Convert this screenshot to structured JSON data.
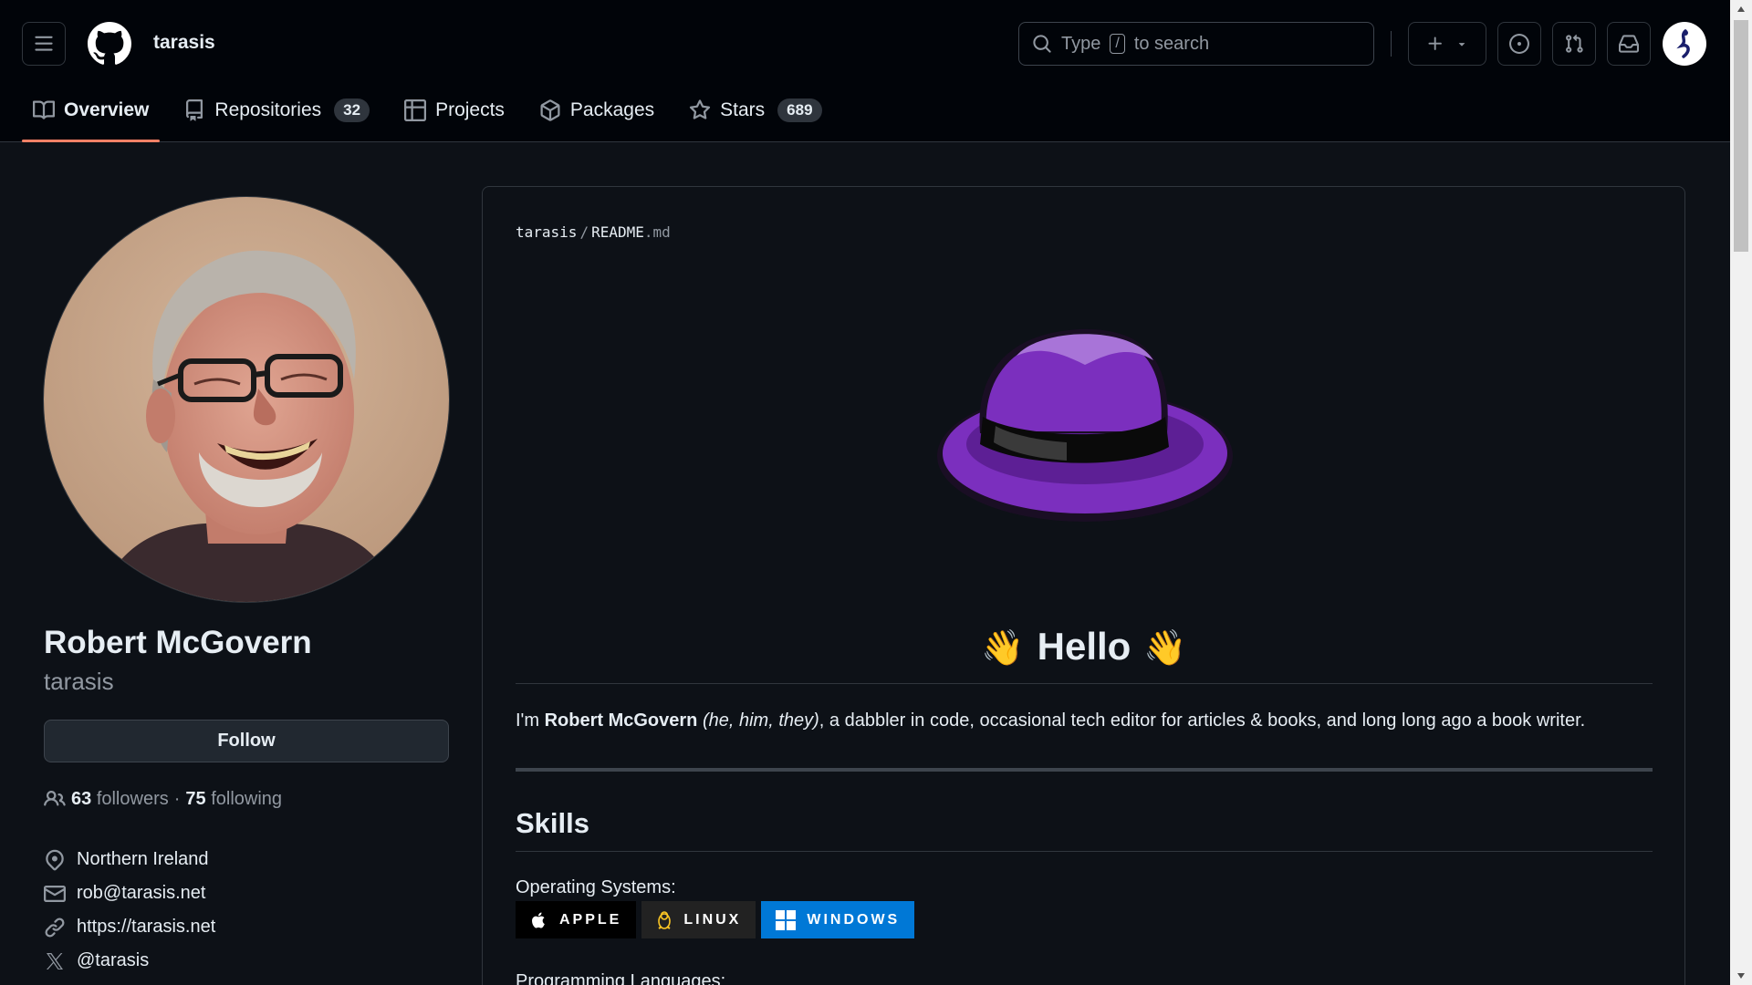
{
  "header": {
    "menu_icon": "hamburger-icon",
    "logo_icon": "github-octocat-icon",
    "owner": "tarasis",
    "search": {
      "prefix": "Type",
      "key": "/",
      "suffix": "to search"
    },
    "buttons": [
      "plus-icon",
      "caret-down-icon",
      "issue-icon",
      "pull-request-icon",
      "inbox-icon"
    ]
  },
  "tabs": [
    {
      "label": "Overview",
      "icon": "book-icon",
      "active": true
    },
    {
      "label": "Repositories",
      "icon": "repo-icon",
      "count": "32"
    },
    {
      "label": "Projects",
      "icon": "table-icon"
    },
    {
      "label": "Packages",
      "icon": "package-icon"
    },
    {
      "label": "Stars",
      "icon": "star-icon",
      "count": "689"
    }
  ],
  "profile": {
    "full_name": "Robert McGovern",
    "login": "tarasis",
    "follow_label": "Follow",
    "followers_count": "63",
    "followers_label": "followers",
    "separator": "·",
    "following_count": "75",
    "following_label": "following",
    "location": "Northern Ireland",
    "email": "rob@tarasis.net",
    "website": "https://tarasis.net",
    "twitter": "@tarasis"
  },
  "readme": {
    "owner": "tarasis",
    "separator": "/",
    "filename": "README",
    "ext": ".md",
    "hello": "Hello",
    "wave_emoji": "👋",
    "intro_prefix": "I'm ",
    "intro_name": "Robert McGovern",
    "intro_pronouns": "(he, him, they)",
    "intro_rest": ", a dabbler in code, occasional tech editor for articles & books, and long long ago a book writer.",
    "skills_heading": "Skills",
    "os_label": "Operating Systems:",
    "badges": [
      {
        "label": "APPLE",
        "icon": "apple-icon",
        "color": "#000000"
      },
      {
        "label": "LINUX",
        "icon": "linux-tux-icon",
        "color": "#222222"
      },
      {
        "label": "WINDOWS",
        "icon": "windows-icon",
        "color": "#0078d6"
      }
    ],
    "prog_label": "Programming Languages:"
  },
  "colors": {
    "background": "#0d1117",
    "header_bg": "#010409",
    "tab_underline": "#f78166",
    "hat_purple": "#7b2fbe"
  }
}
